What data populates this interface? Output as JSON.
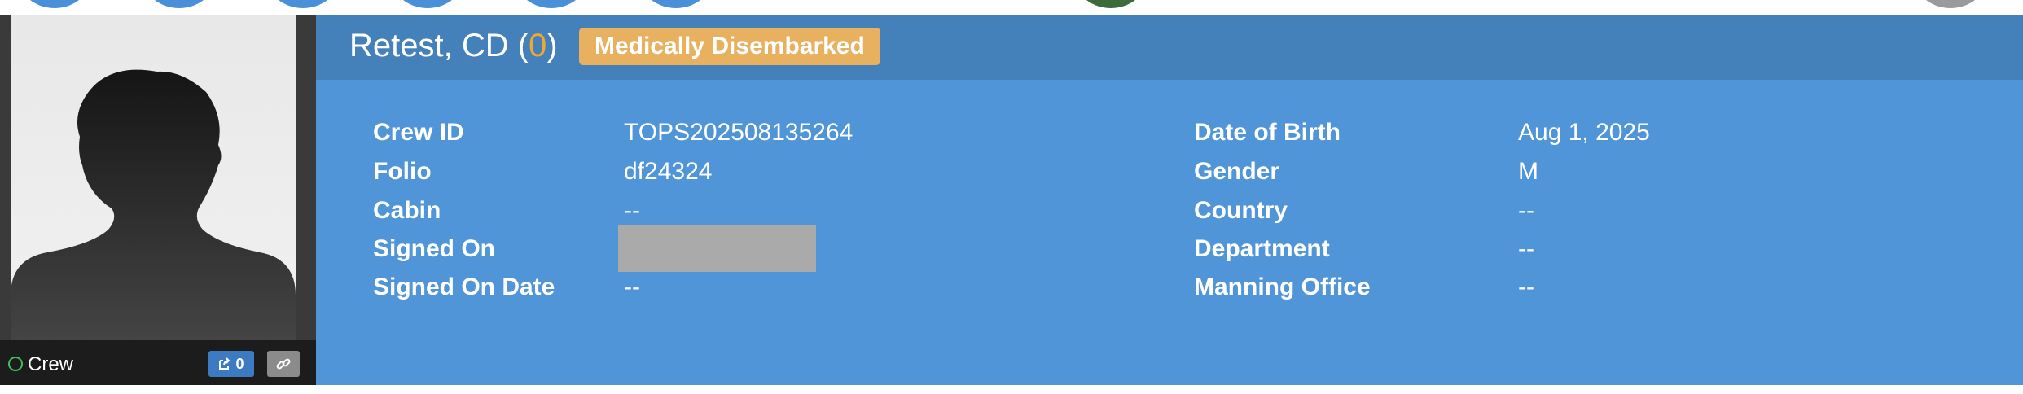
{
  "crew_card": {
    "status_label": "Crew",
    "share_count": "0"
  },
  "profile": {
    "name": "Retest, CD",
    "count": "0",
    "status_badge": "Medically Disembarked"
  },
  "details_left": [
    {
      "label": "Crew ID",
      "value": "TOPS202508135264"
    },
    {
      "label": "Folio",
      "value": "df24324"
    },
    {
      "label": "Cabin",
      "value": "--"
    },
    {
      "label": "Signed On",
      "value": ""
    },
    {
      "label": "Signed On Date",
      "value": "--"
    }
  ],
  "details_right": [
    {
      "label": "Date of Birth",
      "value": "Aug 1, 2025"
    },
    {
      "label": "Gender",
      "value": "M"
    },
    {
      "label": "Country",
      "value": "--"
    },
    {
      "label": "Department",
      "value": "--"
    },
    {
      "label": "Manning Office",
      "value": "--"
    }
  ],
  "colors": {
    "header_bg": "#4480ba",
    "panel_bg": "#4f95d7",
    "badge_bg": "#e8b160",
    "count_color": "#f0a830",
    "online_dot": "#3fbf63"
  }
}
